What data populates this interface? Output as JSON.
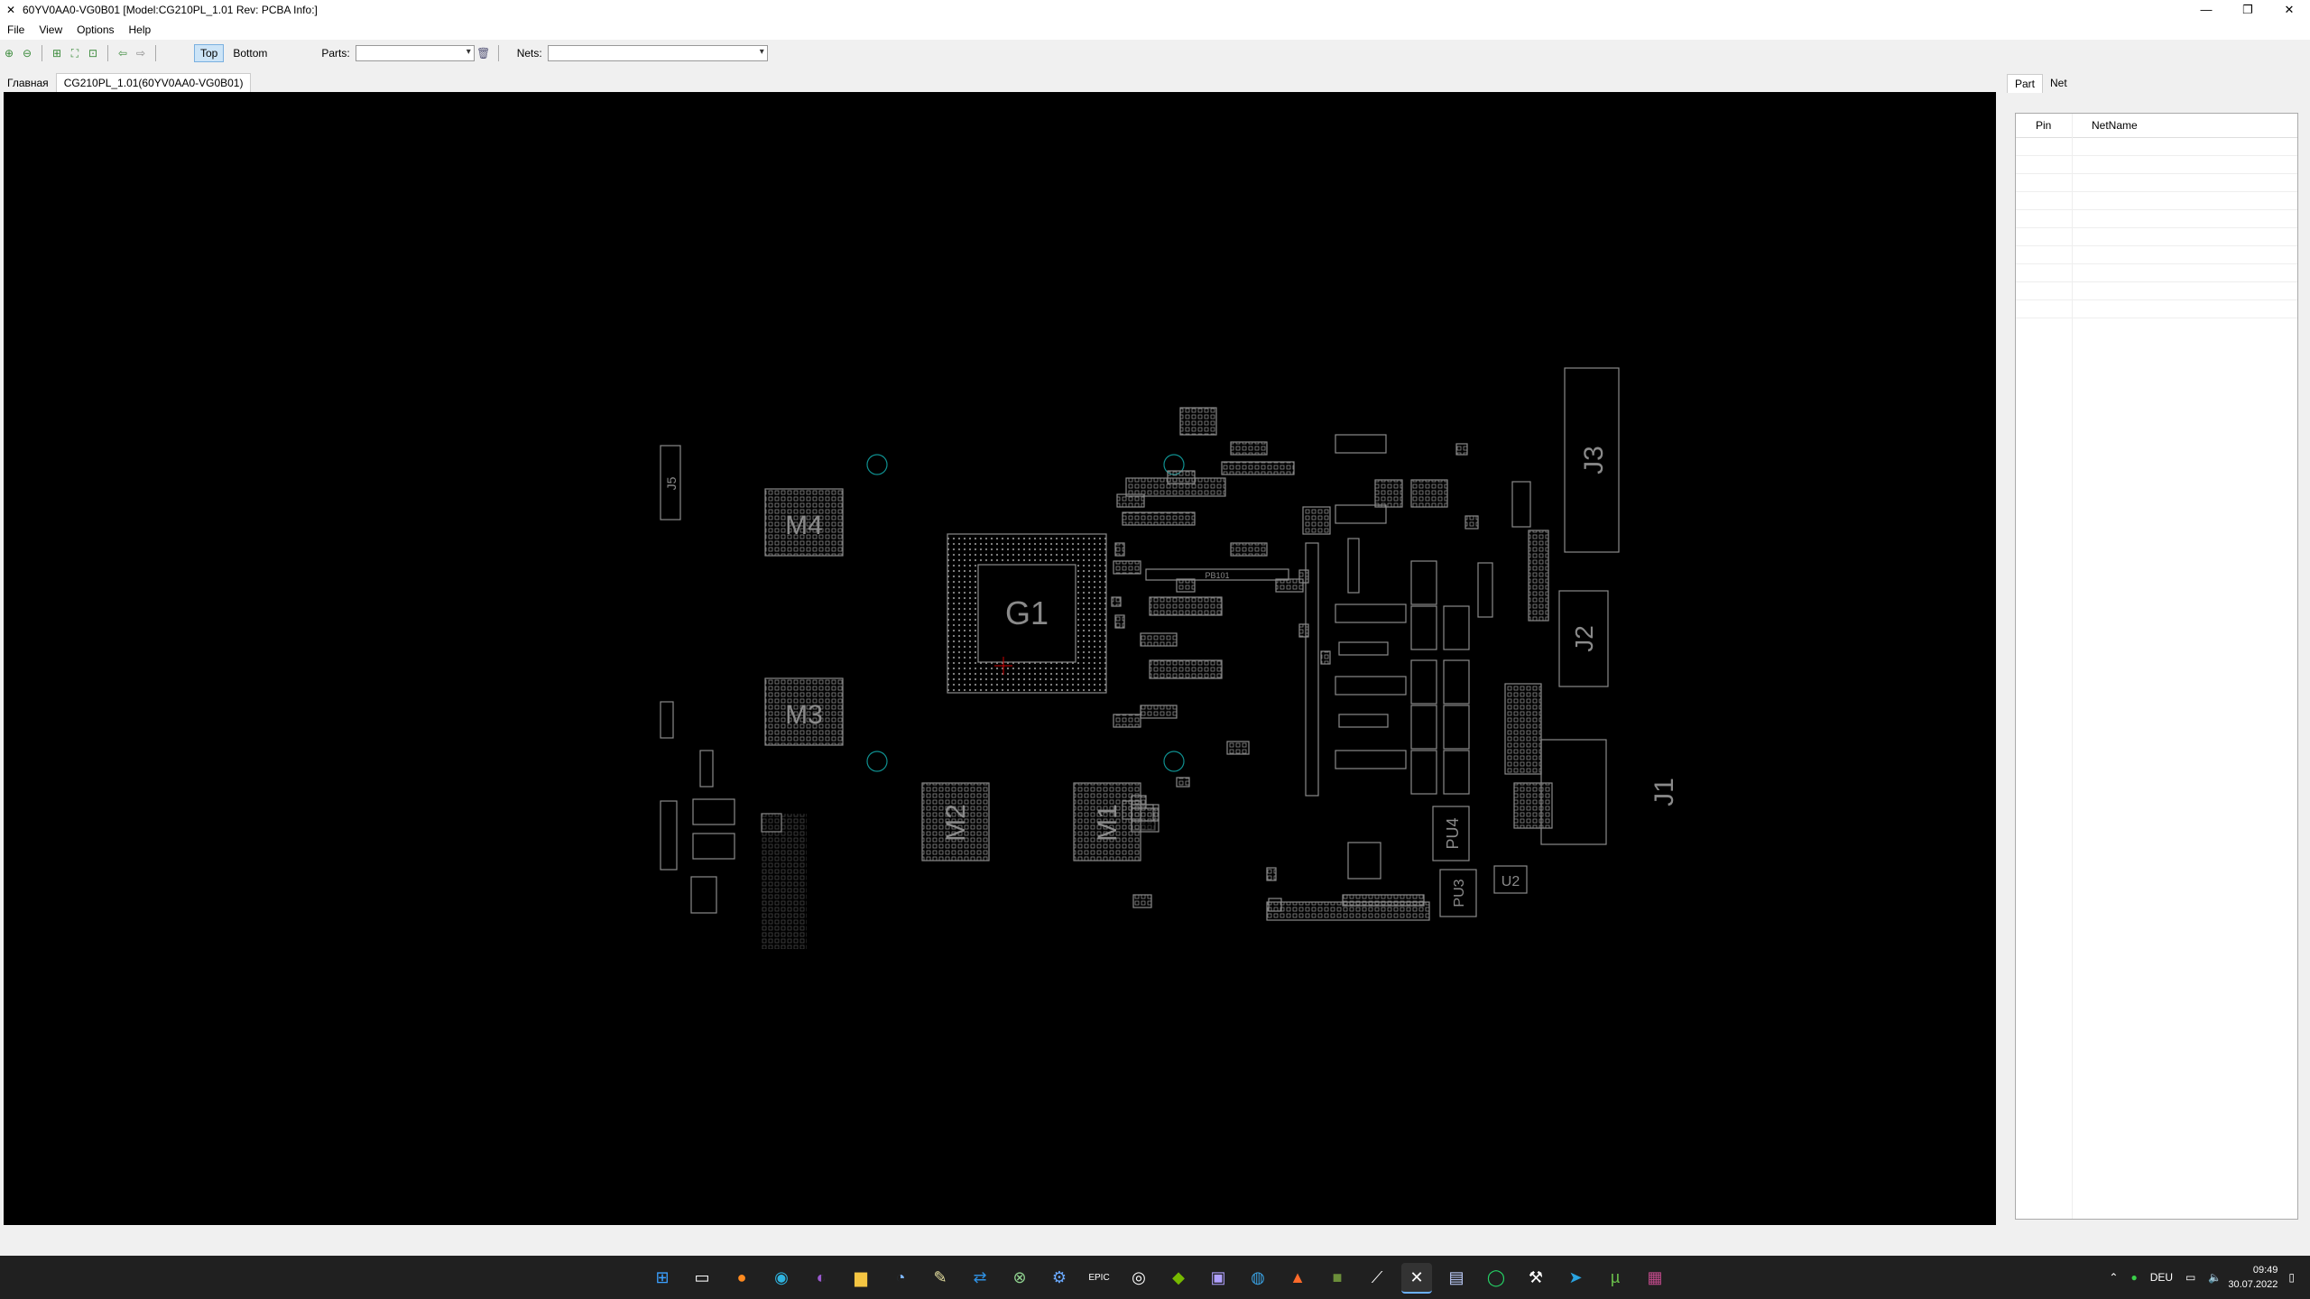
{
  "window": {
    "title": "60YV0AA0-VG0B01 [Model:CG210PL_1.01 Rev: PCBA Info:]"
  },
  "menu": {
    "file": "File",
    "view": "View",
    "options": "Options",
    "help": "Help"
  },
  "toolbar": {
    "top": "Top",
    "bottom": "Bottom",
    "parts_label": "Parts:",
    "nets_label": "Nets:",
    "parts_value": "",
    "nets_value": ""
  },
  "tabs": {
    "home": "Главная",
    "file": "CG210PL_1.01(60YV0AA0-VG0B01)"
  },
  "board": {
    "gpu": "G1",
    "memory": [
      "M4",
      "M3",
      "M2",
      "M1"
    ],
    "connectors": [
      "J3",
      "J2",
      "J1",
      "J5"
    ],
    "power": [
      "PU4",
      "PU3",
      "U2",
      "PB101"
    ]
  },
  "right_panel": {
    "tab_part": "Part",
    "tab_net": "Net",
    "col_pin": "Pin",
    "col_netname": "NetName"
  },
  "taskbar": {
    "lang": "DEU",
    "time": "09:49",
    "date": "30.07.2022"
  },
  "colors": {
    "canvas": "#000000",
    "outline": "#8a8a8a",
    "accent_circle": "#0f8f8f"
  }
}
